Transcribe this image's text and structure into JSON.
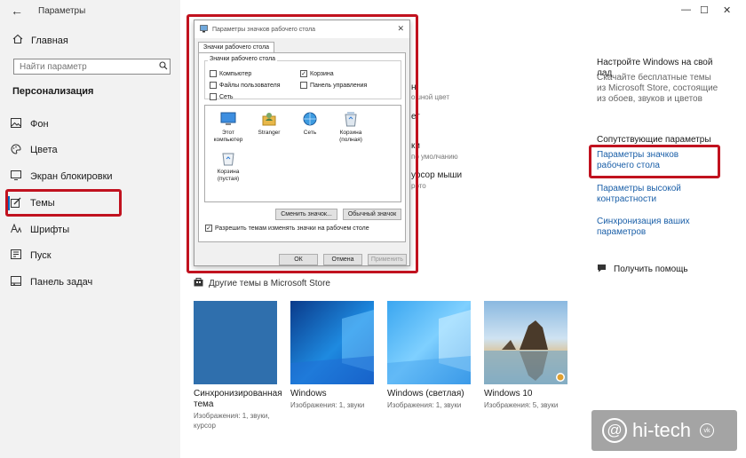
{
  "app": {
    "back_glyph": "←",
    "title": "Параметры"
  },
  "window_controls": {
    "minimize": "—",
    "maximize": "☐",
    "close": "✕"
  },
  "sidebar": {
    "home_label": "Главная",
    "search_placeholder": "Найти параметр",
    "section_title": "Персонализация",
    "items": [
      {
        "label": "Фон",
        "icon": "picture-icon"
      },
      {
        "label": "Цвета",
        "icon": "palette-icon"
      },
      {
        "label": "Экран блокировки",
        "icon": "monitor-icon"
      },
      {
        "label": "Темы",
        "icon": "themes-icon",
        "selected": true
      },
      {
        "label": "Шрифты",
        "icon": "font-icon"
      },
      {
        "label": "Пуск",
        "icon": "start-icon"
      },
      {
        "label": "Панель задач",
        "icon": "taskbar-icon"
      }
    ]
  },
  "background_fragments": {
    "f1": "н",
    "f2": "ошной цвет",
    "f3": "ет",
    "f4": "ки",
    "f5": "по умолчанию",
    "f6": "урсор мыши",
    "f7": "рото"
  },
  "dialog": {
    "title": "Параметры значков рабочего стола",
    "tab": "Значки рабочего стола",
    "group_label": "Значки рабочего стола",
    "checkboxes": [
      {
        "label": "Компьютер",
        "checked": false
      },
      {
        "label": "Корзина",
        "checked": true
      },
      {
        "label": "Файлы пользователя",
        "checked": false
      },
      {
        "label": "Панель управления",
        "checked": false
      },
      {
        "label": "Сеть",
        "checked": false
      }
    ],
    "icons": [
      {
        "label": "Этот компьютер",
        "icon": "computer-icon"
      },
      {
        "label": "Stranger",
        "icon": "user-folder-icon"
      },
      {
        "label": "Сеть",
        "icon": "network-icon"
      },
      {
        "label": "Корзина (полная)",
        "icon": "recycle-bin-full-icon"
      },
      {
        "label": "Корзина (пустая)",
        "icon": "recycle-bin-empty-icon"
      }
    ],
    "change_icon_button": "Сменить значок...",
    "default_icon_button": "Обычный значок",
    "allow_themes_label": "Разрешить темам изменять значки на рабочем столе",
    "allow_themes_checked": true,
    "ok_button": "ОК",
    "cancel_button": "Отмена",
    "apply_button": "Применить"
  },
  "right": {
    "customize_title": "Настройте Windows на свой лад",
    "customize_desc": "Скачайте бесплатные темы из Microsoft Store, состоящие из обоев, звуков и цветов",
    "related_title": "Сопутствующие параметры",
    "link_desktop_icons": "Параметры значков рабочего стола",
    "link_contrast": "Параметры высокой контрастности",
    "link_sync": "Синхронизация ваших параметров",
    "help": "Получить помощь"
  },
  "store_link": "Другие темы в Microsoft Store",
  "themes": [
    {
      "name": "Синхронизированная тема",
      "meta": "Изображения: 1, звуки, курсор"
    },
    {
      "name": "Windows",
      "meta": "Изображения: 1, звуки"
    },
    {
      "name": "Windows (светлая)",
      "meta": "Изображения: 1, звуки"
    },
    {
      "name": "Windows 10",
      "meta": "Изображения: 5, звуки"
    }
  ],
  "watermark": {
    "text": "hi-tech",
    "badge": "vk"
  },
  "colors": {
    "accent": "#0067c0",
    "highlight": "#c1121f",
    "link": "#1a5fa8",
    "sync_theme": "#2f6fad"
  }
}
